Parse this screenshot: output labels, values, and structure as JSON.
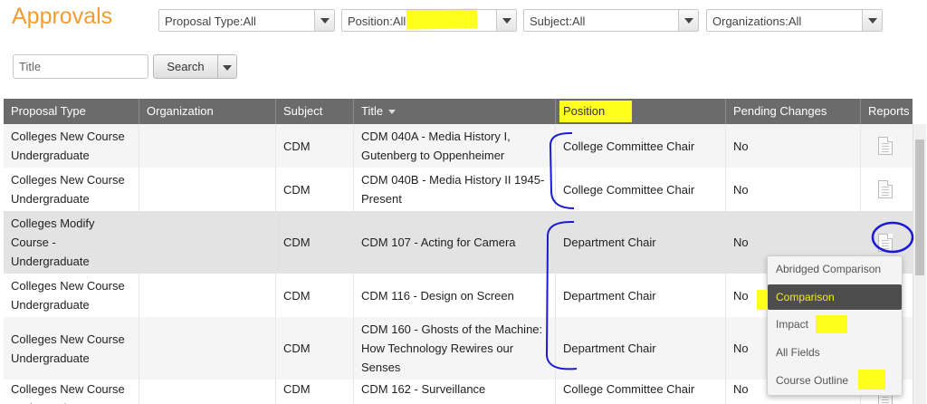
{
  "page": {
    "title": "Approvals"
  },
  "filters": {
    "proposal_type": "Proposal Type:All",
    "position": "Position:All",
    "subject": "Subject:All",
    "organizations": "Organizations:All"
  },
  "search": {
    "placeholder": "Title",
    "button_label": "Search"
  },
  "table": {
    "headers": {
      "proposal_type": "Proposal Type",
      "organization": "Organization",
      "subject": "Subject",
      "title": "Title",
      "position": "Position",
      "pending_changes": "Pending Changes",
      "reports": "Reports"
    },
    "rows": [
      {
        "proposal_type": [
          "Colleges New Course",
          "Undergraduate"
        ],
        "organization": "",
        "subject": "CDM",
        "title": [
          "CDM 040A - Media History I,",
          "Gutenberg to Oppenheimer"
        ],
        "position": "College Committee Chair",
        "pending_changes": "No"
      },
      {
        "proposal_type": [
          "Colleges New Course",
          "Undergraduate"
        ],
        "organization": "",
        "subject": "CDM",
        "title": [
          "CDM 040B - Media History II 1945-",
          "Present"
        ],
        "position": "College Committee Chair",
        "pending_changes": "No"
      },
      {
        "proposal_type": [
          "Colleges Modify",
          "Course -",
          "Undergraduate"
        ],
        "organization": "",
        "subject": "CDM",
        "title": [
          "CDM 107 - Acting for Camera"
        ],
        "position": "Department Chair",
        "pending_changes": "No"
      },
      {
        "proposal_type": [
          "Colleges New Course",
          "Undergraduate"
        ],
        "organization": "",
        "subject": "CDM",
        "title": [
          "CDM 116 - Design on Screen"
        ],
        "position": "Department Chair",
        "pending_changes": "No"
      },
      {
        "proposal_type": [
          "Colleges New Course",
          "Undergraduate"
        ],
        "organization": "",
        "subject": "CDM",
        "title": [
          "CDM 160 - Ghosts of the Machine:",
          "How Technology Rewires our",
          "Senses"
        ],
        "position": "Department Chair",
        "pending_changes": "No"
      },
      {
        "proposal_type": [
          "Colleges New Course",
          "Undergraduate"
        ],
        "organization": "",
        "subject": "CDM",
        "title": [
          "CDM 162 - Surveillance",
          ""
        ],
        "position": "College Committee Chair",
        "pending_changes": "No"
      }
    ]
  },
  "reports_menu": {
    "items": [
      "Abridged Comparison",
      "Comparison",
      "Impact",
      "All Fields",
      "Course Outline"
    ],
    "active_index": 1
  },
  "colors": {
    "accent": "#f39c2f",
    "highlight": "#ffff1e",
    "annotation": "#1a1ad6",
    "header_bg": "#6b6b6b"
  }
}
